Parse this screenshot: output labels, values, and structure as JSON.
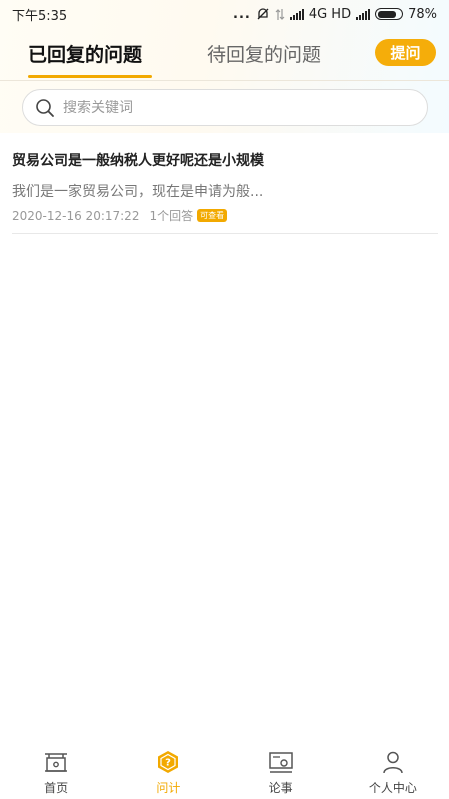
{
  "status_bar": {
    "time": "下午5:35",
    "indicators": "...",
    "network": "4G HD",
    "battery": "78%",
    "battery_level": 0.78
  },
  "tabs": {
    "answered_label": "已回复的问题",
    "pending_label": "待回复的问题",
    "active": "answered",
    "ask_label": "提问"
  },
  "search": {
    "placeholder": "搜索关键词",
    "value": ""
  },
  "questions": [
    {
      "title": "贸易公司是一般纳税人更好呢还是小规模",
      "snippet": "我们是一家贸易公司，现在是申请为般...",
      "datetime": "2020-12-16 20:17:22",
      "answers": "1个回答",
      "badge": "可查看"
    }
  ],
  "bottom_nav": {
    "items": [
      {
        "label": "首页",
        "icon": "home-icon",
        "active": false
      },
      {
        "label": "问计",
        "icon": "question-icon",
        "active": true
      },
      {
        "label": "论事",
        "icon": "discussion-icon",
        "active": false
      },
      {
        "label": "个人中心",
        "icon": "user-icon",
        "active": false
      }
    ]
  },
  "colors": {
    "accent": "#f2a900",
    "ask_button": "#f5ad0a"
  }
}
